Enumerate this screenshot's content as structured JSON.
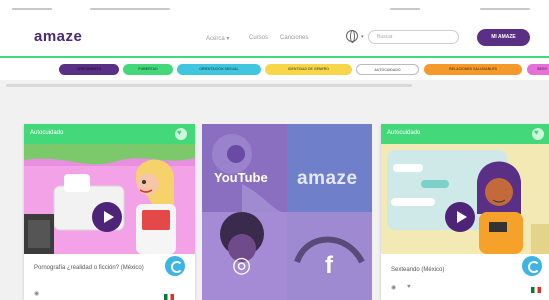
{
  "nav": {
    "logo": "amaze",
    "links": [
      "Acerca ▾",
      "Cursos",
      "Canciones"
    ],
    "search_placeholder": "Buscar",
    "cta_label": "MI AMAZE"
  },
  "filters": {
    "items": [
      {
        "label": "CRECIMIENTO",
        "color": "#5a2f86"
      },
      {
        "label": "PUBERTAD",
        "color": "#43d87a"
      },
      {
        "label": "ORIENTACIÓN SEXUAL",
        "color": "#41c6e0"
      },
      {
        "label": "IDENTIDAD DE GÉNERO",
        "color": "#f7d64a"
      },
      {
        "label": "AUTOCUIDADO",
        "color": "#ffffff"
      },
      {
        "label": "RELACIONES SALUDABLES",
        "color": "#f59a2a"
      },
      {
        "label": "SEXO",
        "color": "#e66fd8"
      }
    ]
  },
  "cards": [
    {
      "category": "Autocuidado",
      "title": "Pornografía ¿realidad o ficción? (México)"
    },
    {
      "category": "Autocuidado",
      "title": "Sexteando (México)"
    }
  ],
  "social": {
    "youtube": "YouTube",
    "brand": "amaze",
    "instagram_glyph": "◎",
    "facebook_glyph": "f"
  },
  "colors": {
    "brand_purple": "#5a2f86",
    "green": "#43d87a",
    "badge_blue": "#3cb4e6"
  }
}
